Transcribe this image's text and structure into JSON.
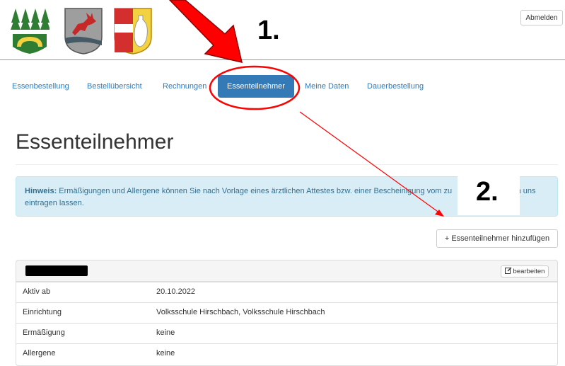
{
  "header": {
    "logos": [
      {
        "name": "trees-crest-logo",
        "colors": [
          "#2e7d32",
          "#f2d240"
        ]
      },
      {
        "name": "deer-crest-logo",
        "colors": [
          "#c62828",
          "#546e7a"
        ]
      },
      {
        "name": "jug-crest-logo",
        "colors": [
          "#d32f2f",
          "#f2d240"
        ]
      }
    ],
    "logout_label": "Abmelden"
  },
  "nav": {
    "items": [
      {
        "label": "Essenbestellung"
      },
      {
        "label": "Bestellübersicht"
      },
      {
        "label": "Rechnungen"
      },
      {
        "label": "Essenteilnehmer",
        "active": true
      },
      {
        "label": "Meine Daten"
      },
      {
        "label": "Dauerbestellung"
      }
    ],
    "accent_color": "#337ab7"
  },
  "annotations": {
    "step1": "1.",
    "step2": "2.",
    "colors": {
      "arrow": "#ff0000"
    }
  },
  "page": {
    "title": "Essenteilnehmer",
    "hint_label": "Hinweis:",
    "hint_line1": "Ermäßigungen und Allergene können Sie nach Vorlage eines ärztlichen Attestes bzw. einer Bescheinigung vom zu",
    "hint_line1_tail": "von uns",
    "hint_line2": "eintragen lassen.",
    "add_button": "+ Essenteilnehmer hinzufügen"
  },
  "participant": {
    "edit_label": "bearbeiten",
    "rows": [
      {
        "key": "Aktiv ab",
        "value": "20.10.2022"
      },
      {
        "key": "Einrichtung",
        "value": "Volksschule Hirschbach, Volksschule Hirschbach"
      },
      {
        "key": "Ermäßigung",
        "value": "keine"
      },
      {
        "key": "Allergene",
        "value": "keine"
      }
    ]
  }
}
